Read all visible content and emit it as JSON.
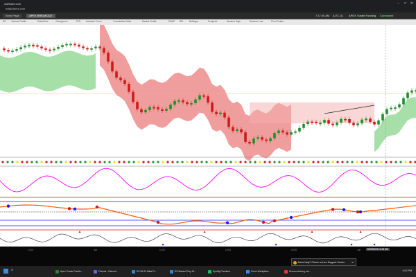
{
  "browser": {
    "url": "olaftrade.com",
    "gmail": "mailtoforex.com"
  },
  "app": {
    "tabs": [
      "Work Page",
      "APEX BREAKOUT"
    ],
    "clock": "7:17:00 AM",
    "session": "(UTC-4)",
    "status": "APEX Trader Funding",
    "conn": "Connected"
  },
  "toolbar": {
    "labels": [
      "ES",
      "Volume Profile",
      "OrderFlow",
      "Divergence",
      "ATR",
      "Indicator Trend",
      "Cumulative Delta",
      "Market Profile",
      "VWAP",
      "RSI",
      "Bollinger",
      "Footprint",
      "Session High",
      "Session Low",
      "Pivot Points"
    ]
  },
  "chart": {
    "bottom_dates": [
      "1.Oct",
      "Jun",
      "11:00",
      "12:00",
      "14:00",
      "Jun"
    ],
    "date_box": "6/26/2024 11:48 AM",
    "price_labels": []
  },
  "toast": {
    "text": "Need help? Check out our Support Center"
  },
  "taskbar": {
    "items": [
      "Apex Trader Fundin...",
      "Friends - Discord",
      "ES 06-24 Mkts Pr...",
      "ES Master Prep W...",
      "Spotify Premium",
      "Zoom Workplace",
      "Screen sharing me..."
    ],
    "right": "5:02 PM"
  },
  "colors": {
    "bull": "#1f8f2a",
    "bear": "#d01a1a",
    "cloud_green": "#5cc45e",
    "cloud_red": "#e44d4d",
    "macd_line": "#ff00ff",
    "osc_blue": "#1a1aff",
    "osc_orange": "#ff5a00"
  }
}
